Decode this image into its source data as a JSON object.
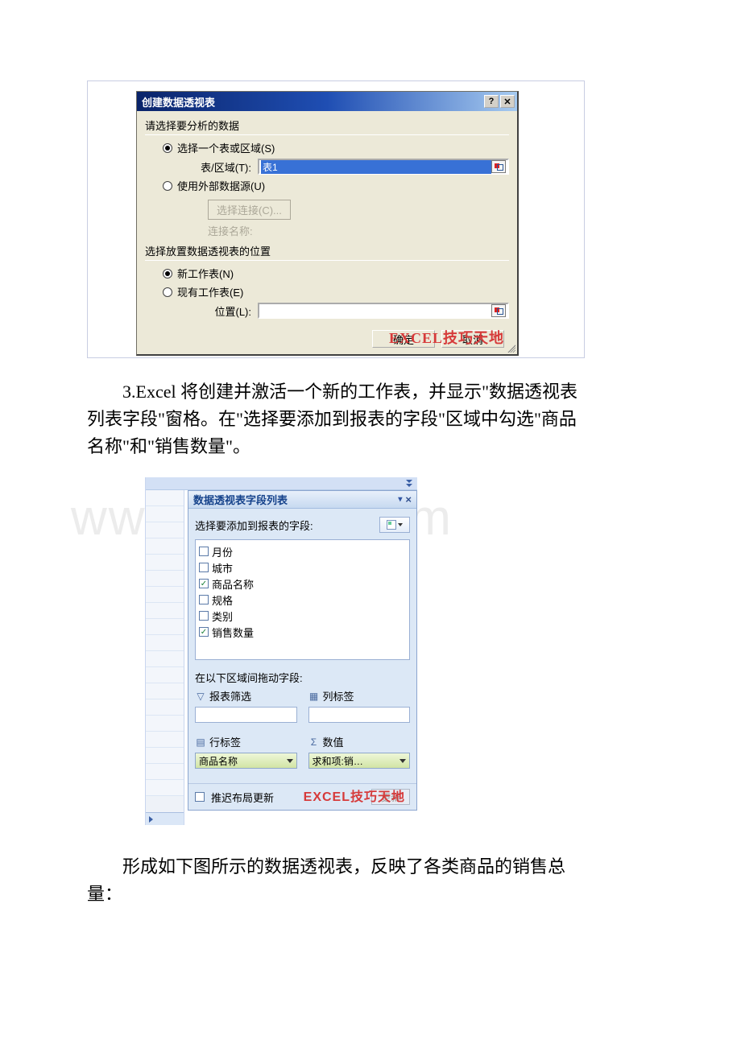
{
  "dialog1": {
    "title": "创建数据透视表",
    "group1_label": "请选择要分析的数据",
    "radio_select_range": "选择一个表或区域(S)",
    "range_label": "表/区域(T):",
    "range_value": "表1",
    "radio_external": "使用外部数据源(U)",
    "choose_conn_btn": "选择连接(C)...",
    "conn_name_label": "连接名称:",
    "group2_label": "选择放置数据透视表的位置",
    "radio_new_sheet": "新工作表(N)",
    "radio_existing_sheet": "现有工作表(E)",
    "location_label": "位置(L):",
    "ok_btn": "确定",
    "cancel_btn": "取消",
    "watermark": "EXCEL技巧天地"
  },
  "para1": "　　3.Excel 将创建并激活一个新的工作表，并显示\"数据透视表列表字段\"窗格。在\"选择要添加到报表的字段\"区域中勾选\"商品名称\"和\"销售数量\"。",
  "taskpane": {
    "title": "数据透视表字段列表",
    "sub_label": "选择要添加到报表的字段:",
    "fields": {
      "f0": "月份",
      "f1": "城市",
      "f2": "商品名称",
      "f3": "规格",
      "f4": "类别",
      "f5": "销售数量"
    },
    "areas_label": "在以下区域间拖动字段:",
    "area_filter": "报表筛选",
    "area_columns": "列标签",
    "area_rows": "行标签",
    "area_values": "数值",
    "row_item": "商品名称",
    "value_item": "求和项:销…",
    "defer_label": "推迟布局更新",
    "update_btn": "更新",
    "watermark": "EXCEL技巧天地"
  },
  "para2": "　　形成如下图所示的数据透视表，反映了各类商品的销售总量：",
  "bg_watermark": "www.bdocx.com"
}
